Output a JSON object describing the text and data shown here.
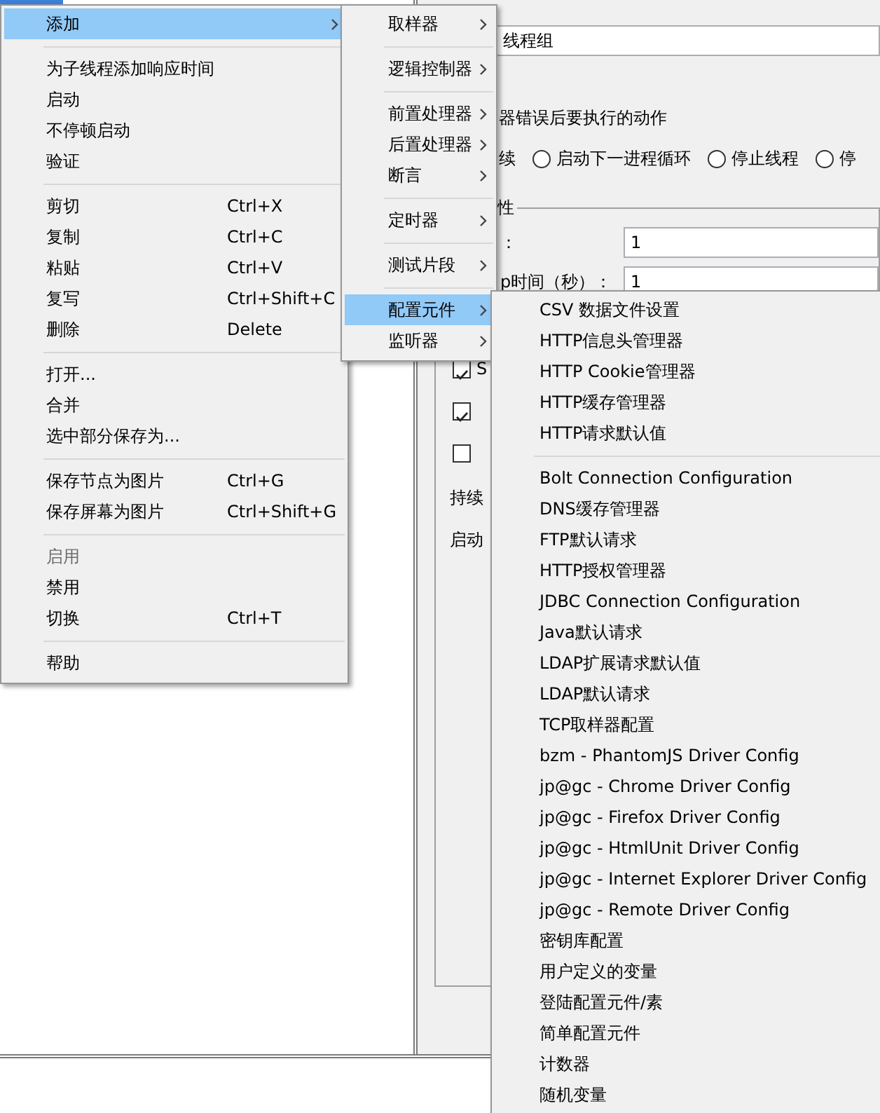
{
  "editor": {
    "name_value": "线程组",
    "error_action_label": "器错误后要执行的动作",
    "continue_label": "续",
    "error_actions": [
      {
        "label": "启动下一进程循环",
        "selected": false
      },
      {
        "label": "停止线程",
        "selected": false
      },
      {
        "label": "停",
        "selected": false
      }
    ],
    "properties_label": "性",
    "fields": [
      {
        "label": "：",
        "value": "1"
      },
      {
        "label": "p时间（秒）：",
        "value": "1"
      }
    ],
    "checkboxes": [
      {
        "label": "S",
        "checked": true
      },
      {
        "checked": true
      },
      {
        "checked": false
      }
    ],
    "cut_labels": [
      "持续",
      "启动"
    ]
  },
  "context_menu": [
    {
      "kind": "item",
      "label": "添加",
      "submenu": true,
      "selected": true
    },
    {
      "kind": "separator"
    },
    {
      "kind": "item",
      "label": "为子线程添加响应时间"
    },
    {
      "kind": "item",
      "label": "启动"
    },
    {
      "kind": "item",
      "label": "不停顿启动"
    },
    {
      "kind": "item",
      "label": "验证"
    },
    {
      "kind": "separator"
    },
    {
      "kind": "item",
      "label": "剪切",
      "shortcut": "Ctrl+X"
    },
    {
      "kind": "item",
      "label": "复制",
      "shortcut": "Ctrl+C"
    },
    {
      "kind": "item",
      "label": "粘贴",
      "shortcut": "Ctrl+V"
    },
    {
      "kind": "item",
      "label": "复写",
      "shortcut": "Ctrl+Shift+C"
    },
    {
      "kind": "item",
      "label": "删除",
      "shortcut": "Delete"
    },
    {
      "kind": "separator"
    },
    {
      "kind": "item",
      "label": "打开..."
    },
    {
      "kind": "item",
      "label": "合并"
    },
    {
      "kind": "item",
      "label": "选中部分保存为..."
    },
    {
      "kind": "separator"
    },
    {
      "kind": "item",
      "label": "保存节点为图片",
      "shortcut": "Ctrl+G"
    },
    {
      "kind": "item",
      "label": "保存屏幕为图片",
      "shortcut": "Ctrl+Shift+G"
    },
    {
      "kind": "separator"
    },
    {
      "kind": "item",
      "label": "启用",
      "disabled": true
    },
    {
      "kind": "item",
      "label": "禁用"
    },
    {
      "kind": "item",
      "label": "切换",
      "shortcut": "Ctrl+T"
    },
    {
      "kind": "separator"
    },
    {
      "kind": "item",
      "label": "帮助"
    }
  ],
  "add_submenu": [
    {
      "kind": "item",
      "label": "取样器",
      "submenu": true
    },
    {
      "kind": "separator"
    },
    {
      "kind": "item",
      "label": "逻辑控制器",
      "submenu": true
    },
    {
      "kind": "separator"
    },
    {
      "kind": "item",
      "label": "前置处理器",
      "submenu": true
    },
    {
      "kind": "item",
      "label": "后置处理器",
      "submenu": true
    },
    {
      "kind": "item",
      "label": "断言",
      "submenu": true
    },
    {
      "kind": "separator"
    },
    {
      "kind": "item",
      "label": "定时器",
      "submenu": true
    },
    {
      "kind": "separator"
    },
    {
      "kind": "item",
      "label": "测试片段",
      "submenu": true
    },
    {
      "kind": "separator"
    },
    {
      "kind": "item",
      "label": "配置元件",
      "submenu": true,
      "selected": true
    },
    {
      "kind": "item",
      "label": "监听器",
      "submenu": true
    }
  ],
  "config_submenu": [
    {
      "kind": "item",
      "label": "CSV 数据文件设置"
    },
    {
      "kind": "item",
      "label": "HTTP信息头管理器"
    },
    {
      "kind": "item",
      "label": "HTTP Cookie管理器"
    },
    {
      "kind": "item",
      "label": "HTTP缓存管理器"
    },
    {
      "kind": "item",
      "label": "HTTP请求默认值"
    },
    {
      "kind": "separator"
    },
    {
      "kind": "item",
      "label": "Bolt Connection Configuration"
    },
    {
      "kind": "item",
      "label": "DNS缓存管理器"
    },
    {
      "kind": "item",
      "label": "FTP默认请求"
    },
    {
      "kind": "item",
      "label": "HTTP授权管理器"
    },
    {
      "kind": "item",
      "label": "JDBC Connection Configuration"
    },
    {
      "kind": "item",
      "label": "Java默认请求"
    },
    {
      "kind": "item",
      "label": "LDAP扩展请求默认值"
    },
    {
      "kind": "item",
      "label": "LDAP默认请求"
    },
    {
      "kind": "item",
      "label": "TCP取样器配置"
    },
    {
      "kind": "item",
      "label": "bzm - PhantomJS Driver Config"
    },
    {
      "kind": "item",
      "label": "jp@gc - Chrome Driver Config"
    },
    {
      "kind": "item",
      "label": "jp@gc - Firefox Driver Config"
    },
    {
      "kind": "item",
      "label": "jp@gc - HtmlUnit Driver Config"
    },
    {
      "kind": "item",
      "label": "jp@gc - Internet Explorer Driver Config"
    },
    {
      "kind": "item",
      "label": "jp@gc - Remote Driver Config"
    },
    {
      "kind": "item",
      "label": "密钥库配置"
    },
    {
      "kind": "item",
      "label": "用户定义的变量"
    },
    {
      "kind": "item",
      "label": "登陆配置元件/素"
    },
    {
      "kind": "item",
      "label": "简单配置元件"
    },
    {
      "kind": "item",
      "label": "计数器"
    },
    {
      "kind": "item",
      "label": "随机变量"
    }
  ]
}
